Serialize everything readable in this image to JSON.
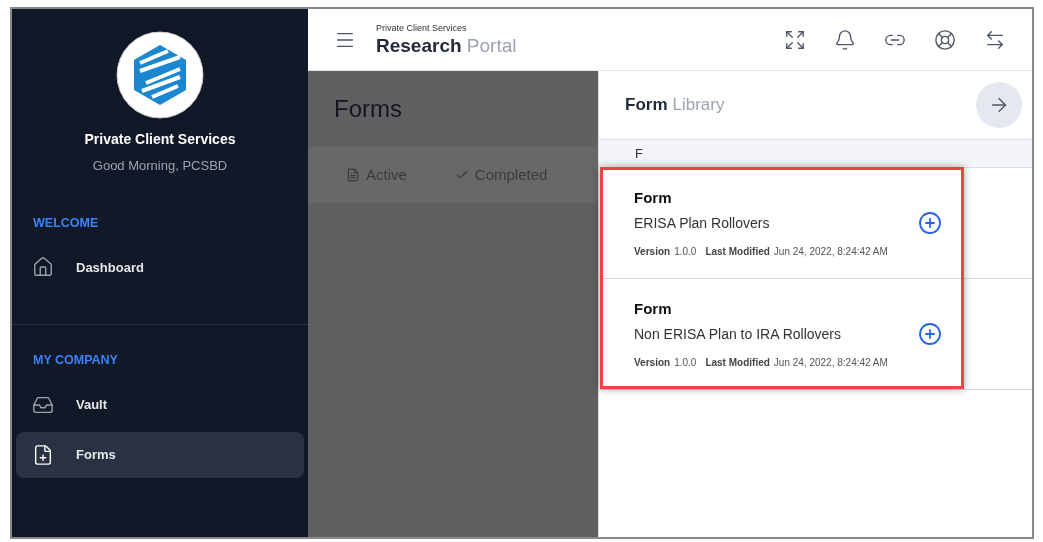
{
  "sidebar": {
    "org_name": "Private Client Services",
    "greeting": "Good Morning, PCSBD",
    "sections": [
      {
        "title": "WELCOME",
        "items": [
          {
            "label": "Dashboard",
            "kind": "home",
            "selected": false
          }
        ]
      },
      {
        "title": "MY COMPANY",
        "items": [
          {
            "label": "Vault",
            "kind": "inbox",
            "selected": false
          },
          {
            "label": "Forms",
            "kind": "form",
            "selected": true
          }
        ]
      }
    ]
  },
  "header": {
    "subtitle": "Private Client Services",
    "title_bold": "Research",
    "title_light": "Portal"
  },
  "page": {
    "title": "Forms",
    "tabs": [
      {
        "label": "Active",
        "kind": "open"
      },
      {
        "label": "Completed",
        "kind": "done"
      }
    ]
  },
  "panel": {
    "title_bold": "Form",
    "title_light": "Library",
    "group": "F",
    "items": [
      {
        "type": "Form",
        "name": "ERISA Plan Rollovers",
        "version_label": "Version",
        "version": "1.0.0",
        "modified_label": "Last Modified",
        "modified": "Jun 24, 2022, 8:24:42 AM"
      },
      {
        "type": "Form",
        "name": "Non ERISA Plan to IRA Rollovers",
        "version_label": "Version",
        "version": "1.0.0",
        "modified_label": "Last Modified",
        "modified": "Jun 24, 2022, 8:24:42 AM"
      }
    ]
  }
}
